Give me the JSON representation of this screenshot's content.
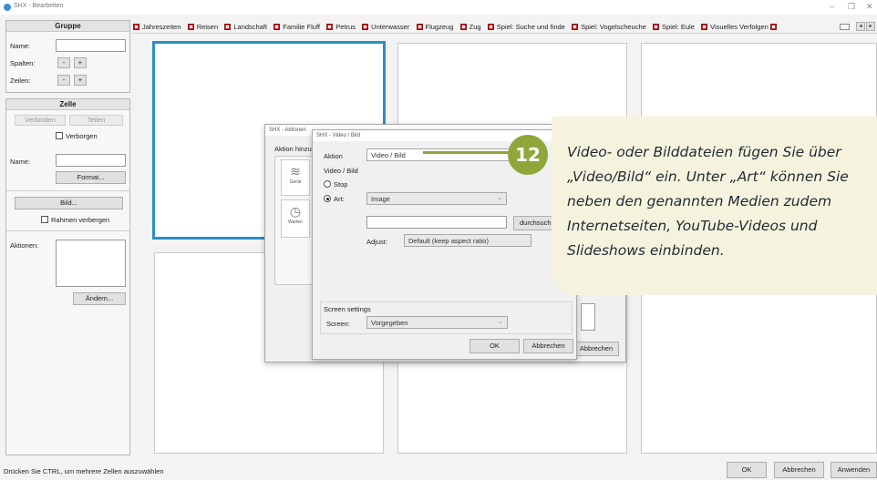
{
  "window": {
    "title": "SHX - Bearbeiten",
    "minimize": "–",
    "maximize": "❐",
    "close": "✕"
  },
  "left_panel": {
    "gruppe": {
      "header": "Gruppe",
      "name_label": "Name:",
      "spalten_label": "Spalten:",
      "zeilen_label": "Zeilen:",
      "minus": "-",
      "plus": "+"
    },
    "zelle": {
      "header": "Zelle",
      "verbinden": "Verbinden",
      "teilen": "Teilen",
      "verborgen": "Verborgen",
      "name_label": "Name:",
      "format": "Format...",
      "bild": "Bild...",
      "rahmen": "Rahmen verbergen",
      "aktionen_label": "Aktionen:",
      "aendern": "Ändern..."
    }
  },
  "tabs": [
    "Jahreszeiten",
    "Reisen",
    "Landschaft",
    "Familie Fluff",
    "Petrus",
    "Unterwasser",
    "Flugzeug",
    "Zug",
    "Spiel: Suche und finde",
    "Spiel: Vogelscheuche",
    "Spiel: Eule",
    "Visuelles Verfolgen"
  ],
  "tab_nav": {
    "prev": "◂",
    "next": "▸"
  },
  "aktionen_dialog": {
    "title": "SHX - Aktionen",
    "label": "Aktion hinzu",
    "item1": "Gerät",
    "item2": "Warten",
    "cancel": "Abbrechen"
  },
  "video_dialog": {
    "title": "SHX - Video / Bild",
    "aktion_label": "Aktion",
    "aktion_value": "Video / Bild",
    "group_label": "Video / Bild",
    "stop_label": "Stop",
    "art_label": "Art:",
    "art_value": "Image",
    "browse": "durchsuchen",
    "adjust_label": "Adjust:",
    "adjust_value": "Default (keep aspect ratio)",
    "screen_settings": "Screen settings",
    "screen_label": "Screen:",
    "screen_value": "Vorgegeben",
    "ok": "OK",
    "cancel": "Abbrechen"
  },
  "callout": {
    "number": "12",
    "text": "Video- oder Bilddateien fügen Sie über „Video/Bild“ ein. Unter „Art“ können Sie neben den genannten Medien zudem Internetseiten, YouTube-Videos und Slideshows einbinden."
  },
  "footer": {
    "status": "Drücken Sie CTRL, um mehrere Zellen auszuwählen",
    "ok": "OK",
    "cancel": "Abbrechen",
    "apply": "Anwenden"
  },
  "colors": {
    "accent": "#2b8fc6",
    "callout_bg": "#f5f3de",
    "badge": "#8fa73a"
  }
}
